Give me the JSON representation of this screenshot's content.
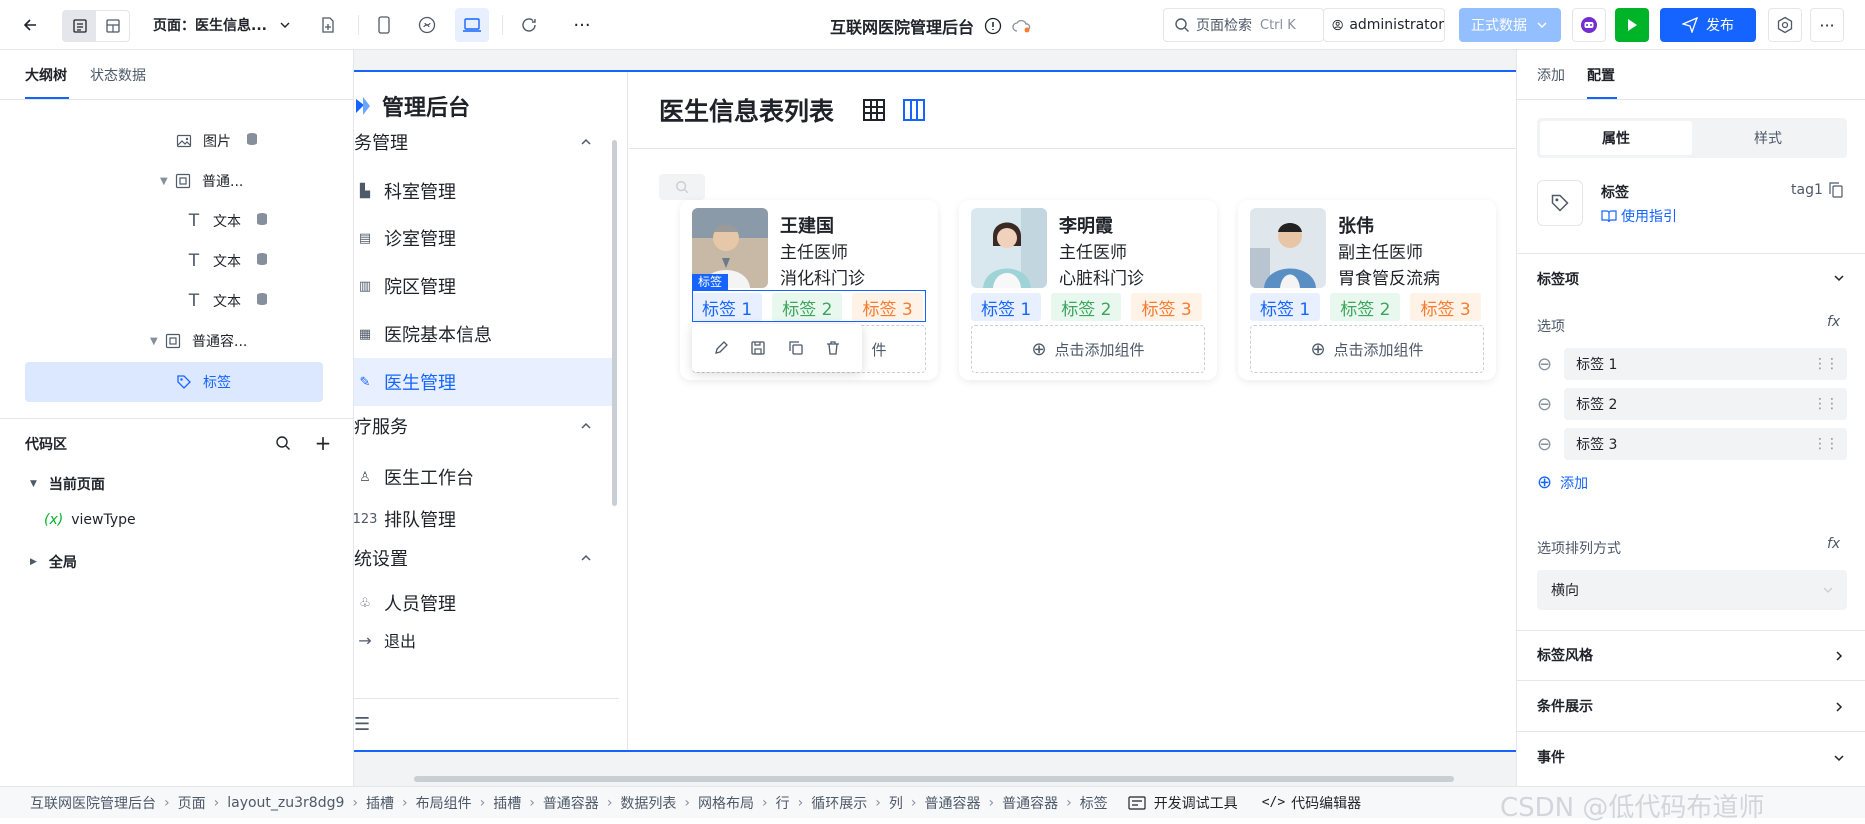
{
  "topbar": {
    "page_label": "页面：医生信息...",
    "app_title": "互联网医院管理后台",
    "search_placeholder": "页面检索",
    "search_shortcut": "Ctrl K",
    "user": "administrator",
    "env": "正式数据",
    "publish": "发布"
  },
  "left": {
    "tabs": [
      "大纲树",
      "状态数据"
    ],
    "tree": [
      {
        "label": "图片",
        "icon": "image-icon",
        "db": true
      },
      {
        "label": "普通...",
        "icon": "container-icon",
        "db": false
      },
      {
        "label": "文本",
        "icon": "text-icon",
        "db": true
      },
      {
        "label": "文本",
        "icon": "text-icon",
        "db": true
      },
      {
        "label": "文本",
        "icon": "text-icon",
        "db": true
      },
      {
        "label": "普通容...",
        "icon": "container-icon",
        "db": false
      },
      {
        "label": "标签",
        "icon": "tag-icon",
        "db": false
      }
    ],
    "code_title": "代码区",
    "code_tree": [
      "当前页面",
      "viewType",
      "全局"
    ]
  },
  "app": {
    "logo_title": "管理后台",
    "page_title": "医生信息表列表",
    "nav": [
      {
        "type": "group",
        "label": "务管理"
      },
      {
        "type": "item",
        "label": "科室管理"
      },
      {
        "type": "item",
        "label": "诊室管理"
      },
      {
        "type": "item",
        "label": "院区管理"
      },
      {
        "type": "item",
        "label": "医院基本信息"
      },
      {
        "type": "item",
        "label": "医生管理"
      },
      {
        "type": "group",
        "label": "疗服务"
      },
      {
        "type": "item",
        "label": "医生工作台"
      },
      {
        "type": "item",
        "label": "排队管理"
      },
      {
        "type": "group",
        "label": "统设置"
      },
      {
        "type": "item",
        "label": "人员管理"
      },
      {
        "type": "logout",
        "label": "退出"
      }
    ],
    "cards": [
      {
        "name": "王建国",
        "title": "主任医师",
        "dept": "消化科门诊",
        "tags": [
          "标签 1",
          "标签 2",
          "标签 3"
        ],
        "add": "点击添加组件"
      },
      {
        "name": "李明霞",
        "title": "主任医师",
        "dept": "心脏科门诊",
        "tags": [
          "标签 1",
          "标签 2",
          "标签 3"
        ],
        "add": "点击添加组件"
      },
      {
        "name": "张伟",
        "title": "副主任医师",
        "dept": "胃食管反流病",
        "tags": [
          "标签 1",
          "标签 2",
          "标签 3"
        ],
        "add": "点击添加组件"
      }
    ],
    "selected_badge": "标签"
  },
  "right": {
    "tabs": [
      "添加",
      "配置"
    ],
    "seg": [
      "属性",
      "样式"
    ],
    "comp_name": "标签",
    "comp_id": "tag1",
    "guide": "使用指引",
    "section_tag_items": "标签项",
    "options_label": "选项",
    "options": [
      "标签 1",
      "标签 2",
      "标签 3"
    ],
    "add": "添加",
    "layout_label": "选项排列方式",
    "layout_value": "横向",
    "tag_style": "标签风格",
    "condition": "条件展示",
    "events": "事件"
  },
  "bottom": {
    "crumbs": [
      "互联网医院管理后台",
      "页面",
      "layout_zu3r8dg9",
      "插槽",
      "布局组件",
      "插槽",
      "普通容器",
      "数据列表",
      "网格布局",
      "行",
      "循环展示",
      "列",
      "普通容器",
      "普通容器",
      "标签"
    ],
    "devtools": "开发调试工具",
    "code_editor": "代码编辑器",
    "watermark": "CSDN @低代码布道师"
  },
  "colors": {
    "primary": "#1664ff",
    "green": "#00b42a",
    "purple": "#722ed1"
  }
}
